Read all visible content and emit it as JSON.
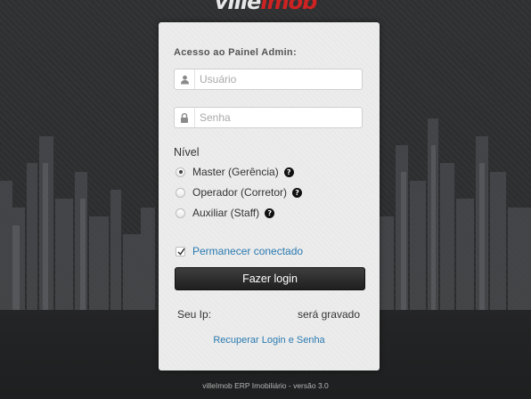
{
  "brand": {
    "logo_part1": "ville",
    "logo_part2": "imob"
  },
  "login": {
    "title": "Acesso ao Painel Admin:",
    "username_placeholder": "Usuário",
    "password_placeholder": "Senha",
    "level_label": "Nível",
    "levels": [
      {
        "label": "Master (Gerência)",
        "checked": true
      },
      {
        "label": "Operador (Corretor)",
        "checked": false
      },
      {
        "label": "Auxiliar (Staff)",
        "checked": false
      }
    ],
    "remember_label": "Permanecer conectado",
    "remember_checked": true,
    "submit_label": "Fazer login",
    "ip_label": "Seu Ip:",
    "ip_value": "será gravado",
    "recover_link": "Recuperar Login e Senha"
  },
  "footer": {
    "version_text": "villeImob ERP Imobiliário - versão 3.0"
  },
  "colors": {
    "link": "#2a7ab0",
    "brand_red": "#cf2222",
    "button": "#2a2a2a"
  },
  "icons": {
    "user": "user-icon",
    "lock": "lock-icon",
    "help": "question-circle-icon",
    "check": "check-icon"
  }
}
